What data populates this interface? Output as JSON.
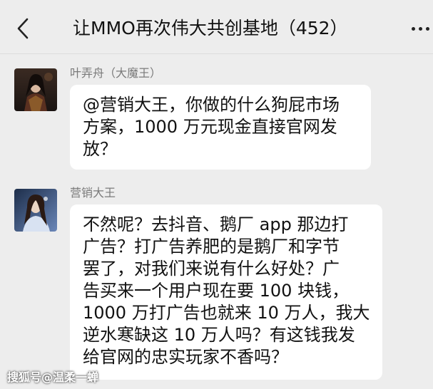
{
  "header": {
    "title": "让MMO再次伟大共创基地（452）",
    "back_icon": "chevron-left-icon",
    "more_icon": "more-dots-icon"
  },
  "messages": [
    {
      "sender": "叶弄舟（大魔王）",
      "text": "@营销大王，你做的什么狗屁市场\n方案，1000 万元现金直接官网发\n放？"
    },
    {
      "sender": "营销大王",
      "text": "不然呢？去抖音、鹅厂 app 那边打\n广告？打广告养肥的是鹅厂和字节\n罢了，对我们来说有什么好处？广\n告买来一个用户现在要 100 块钱，\n1000 万打广告也就来 10 万人，我大\n逆水寒缺这 10 万人吗？有这钱我发\n给官网的忠实玩家不香吗？"
    }
  ],
  "watermark": "搜狐号@温柔一蝉",
  "colors": {
    "background": "#ededed",
    "bubble": "#ffffff",
    "sender_name": "#7a7a7a"
  }
}
